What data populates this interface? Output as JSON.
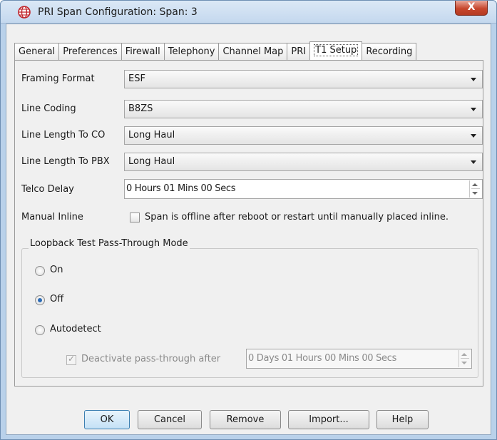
{
  "window": {
    "title": "PRI Span Configuration: Span: 3",
    "close_label": "X"
  },
  "tabs": [
    {
      "label": "General"
    },
    {
      "label": "Preferences"
    },
    {
      "label": "Firewall"
    },
    {
      "label": "Telephony"
    },
    {
      "label": "Channel Map"
    },
    {
      "label": "PRI"
    },
    {
      "label": "T1 Setup",
      "active": true
    },
    {
      "label": "Recording"
    }
  ],
  "form": {
    "framing_format": {
      "label": "Framing Format",
      "value": "ESF"
    },
    "line_coding": {
      "label": "Line Coding",
      "value": "B8ZS"
    },
    "line_length_co": {
      "label": "Line Length To CO",
      "value": "Long Haul"
    },
    "line_length_pbx": {
      "label": "Line Length To PBX",
      "value": "Long Haul"
    },
    "telco_delay": {
      "label": "Telco Delay",
      "value": "0 Hours 01 Mins 00 Secs"
    },
    "manual_inline": {
      "label": "Manual Inline",
      "checkbox_label": "Span is offline after reboot or restart until manually placed inline.",
      "checked": false
    }
  },
  "loopback": {
    "title": "Loopback Test Pass-Through Mode",
    "options": [
      {
        "label": "On",
        "selected": false
      },
      {
        "label": "Off",
        "selected": true
      },
      {
        "label": "Autodetect",
        "selected": false
      }
    ],
    "deactivate_label": "Deactivate pass-through after",
    "deactivate_checked": true,
    "deactivate_value": "0 Days 01 Hours 00 Mins 00 Secs"
  },
  "buttons": {
    "ok": "OK",
    "cancel": "Cancel",
    "remove": "Remove",
    "import": "Import...",
    "help": "Help"
  }
}
